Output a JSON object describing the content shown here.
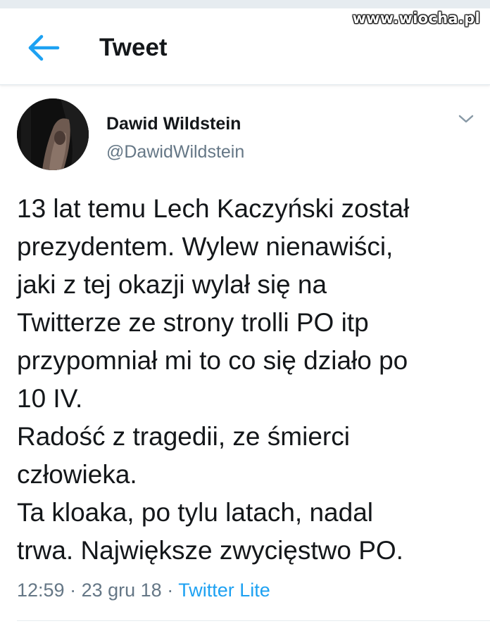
{
  "watermark": "www.wiocha.pl",
  "header": {
    "back_icon": "arrow-left-icon",
    "title": "Tweet"
  },
  "tweet": {
    "author_name": "Dawid Wildstein",
    "author_handle": "@DawidWildstein",
    "menu_icon": "chevron-down-icon",
    "text": "13 lat temu Lech Kaczyński został\nprezydentem. Wylew nienawiści,\njaki z tej okazji wylał się na\nTwitterze ze strony trolli PO itp\nprzypomniał mi to co się działo po\n10 IV.\nRadość z tragedii, ze śmierci\nczłowieka.\nTa kloaka, po tylu latach, nadal\ntrwa. Największe zwycięstwo PO.",
    "time": "12:59",
    "separator": "·",
    "date": "23 gru 18",
    "source": "Twitter Lite"
  },
  "colors": {
    "accent": "#1da1f2",
    "secondary_text": "#657786",
    "primary_text": "#14171a"
  }
}
